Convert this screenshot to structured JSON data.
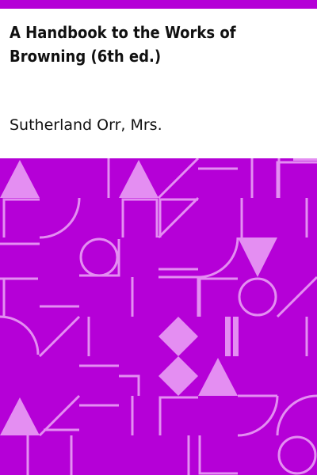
{
  "cover": {
    "title": "A Handbook to the Works of Browning (6th ed.)",
    "author": "Sutherland Orr, Mrs.",
    "colors": {
      "background": "#b500d7",
      "shape": "#e48ef2",
      "top_bar": "#b500d7",
      "text": "#111111"
    }
  }
}
